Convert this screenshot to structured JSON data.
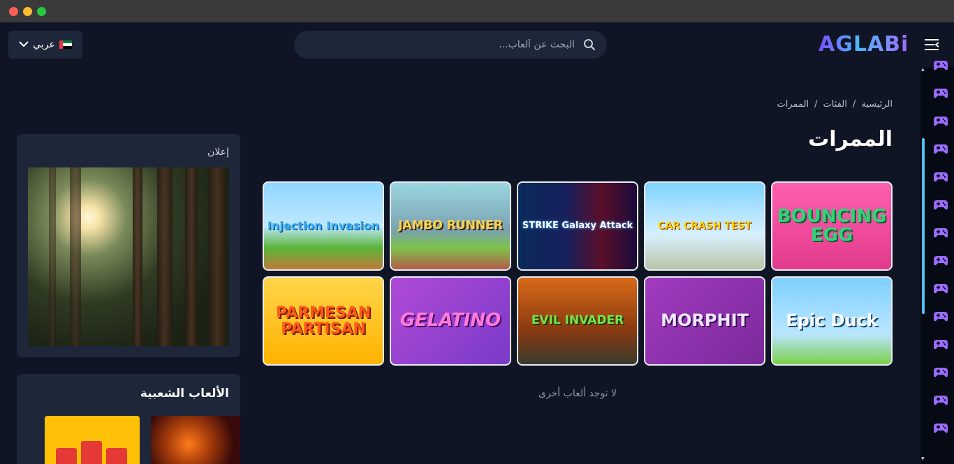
{
  "header": {
    "logo": "AGLABi",
    "search_placeholder": "البحث عن ألعاب...",
    "language_label": "عربي"
  },
  "breadcrumb": {
    "home": "الرئيسية",
    "sep1": "/",
    "categories": "الفئات",
    "sep2": "/",
    "current": "الممرات"
  },
  "page_title": "الممرات",
  "games": [
    {
      "title": "BOUNCING EGG"
    },
    {
      "title": "CAR CRASH TEST"
    },
    {
      "title": "STRIKE Galaxy Attack"
    },
    {
      "title": "JAMBO RUNNER"
    },
    {
      "title": "Injection Invasion"
    },
    {
      "title": "Epic Duck"
    },
    {
      "title": "MORPHIT"
    },
    {
      "title": "EVIL INVADER"
    },
    {
      "title": "GELATINO"
    },
    {
      "title": "PARMESAN PARTISAN"
    }
  ],
  "no_more_text": "لا توجد ألعاب أخرى",
  "ad": {
    "label": "إعلان"
  },
  "popular": {
    "title": "الألعاب الشعبية"
  },
  "colors": {
    "background": "#0f1525",
    "card": "#1e2739",
    "accent": "#4fc3f7",
    "logo_gradient_start": "#7c4dff",
    "logo_gradient_end": "#4fb6ff"
  }
}
